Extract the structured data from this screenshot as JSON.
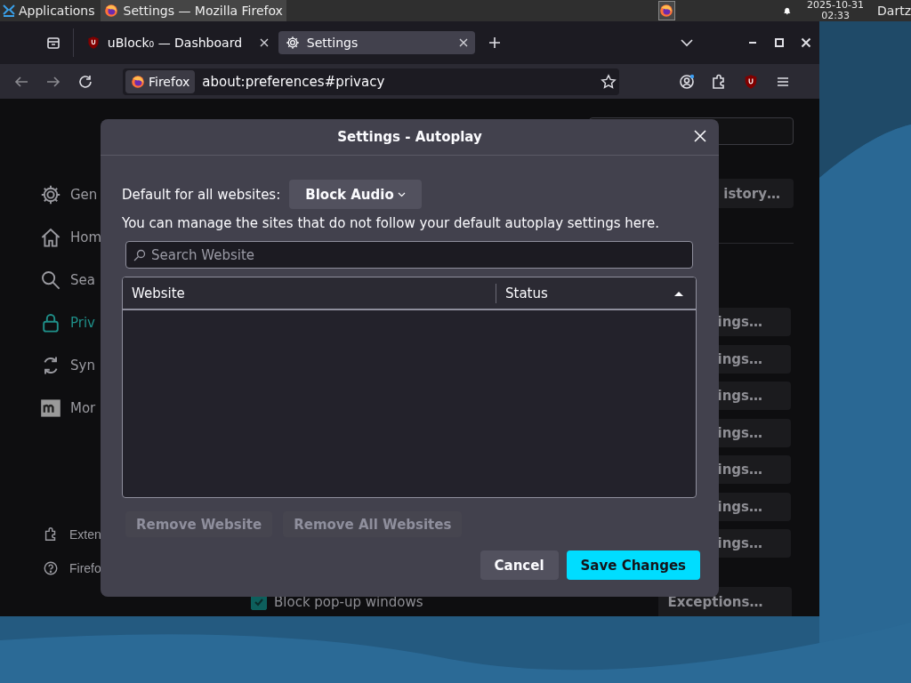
{
  "taskbar": {
    "menu_label": "Applications",
    "tasks": [
      {
        "label": "Settings — Mozilla Firefox",
        "selected": true
      }
    ],
    "date": "2025-10-31",
    "time": "02:33",
    "user": "Dartz"
  },
  "browser": {
    "tabs": [
      {
        "label": "uBlock₀ — Dashboard",
        "selected": false
      },
      {
        "label": "Settings",
        "selected": true
      }
    ],
    "identity": "Firefox",
    "address": "about:preferences#privacy"
  },
  "preferences": {
    "sidebar": [
      {
        "label": "Gen",
        "selected": false
      },
      {
        "label": "Hom",
        "selected": false
      },
      {
        "label": "Sea",
        "selected": false
      },
      {
        "label": "Priv",
        "selected": true
      },
      {
        "label": "Syn",
        "selected": false
      },
      {
        "label": "Mor",
        "selected": false
      }
    ],
    "footer_links": [
      "Exten",
      "Firefo"
    ],
    "history_button": "istory…",
    "settings_buttons": [
      "ings…",
      "ings…",
      "ings…",
      "ings…",
      "ings…",
      "ings…",
      "ings…"
    ],
    "popup_checkbox": {
      "label": "Block pop-up windows",
      "checked": true
    },
    "exceptions_button": "Exceptions…"
  },
  "dialog": {
    "title": "Settings - Autoplay",
    "default_label": "Default for all websites:",
    "default_value": "Block Audio",
    "description": "You can manage the sites that do not follow your default autoplay settings here.",
    "search": {
      "placeholder": "Search Website"
    },
    "columns": [
      {
        "label": "Website",
        "sorted": false
      },
      {
        "label": "Status",
        "sorted": true
      }
    ],
    "row_buttons": [
      {
        "label": "Remove Website",
        "disabled": true
      },
      {
        "label": "Remove All Websites",
        "disabled": true
      }
    ],
    "footer_buttons": [
      {
        "label": "Cancel",
        "kind": "secondary"
      },
      {
        "label": "Save Changes",
        "kind": "primary"
      }
    ]
  }
}
